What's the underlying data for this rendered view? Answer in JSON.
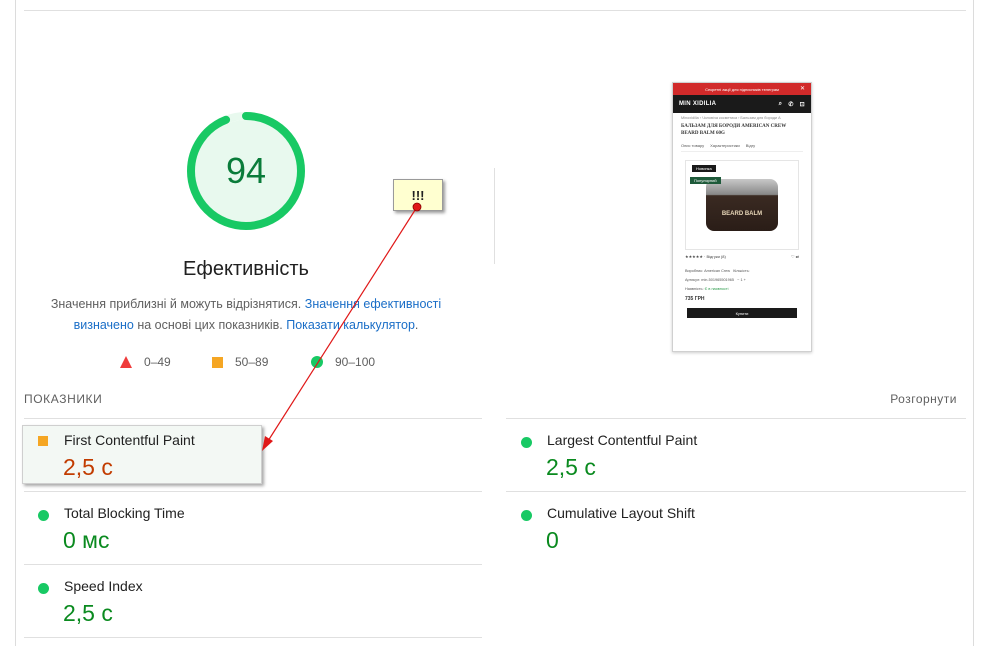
{
  "score": {
    "value": "94",
    "fraction": 0.94,
    "title": "Ефективність",
    "color": "#18c964"
  },
  "description": {
    "part1": "Значення приблизні й можуть відрізнятися. ",
    "link1": "Значення ефективності визначено",
    "part2": " на основі цих показників. ",
    "link2": "Показати калькулятор",
    "part3": "."
  },
  "legend": {
    "fail": "0–49",
    "average": "50–89",
    "pass": "90–100"
  },
  "thumbnail": {
    "banner": "Секретні акції для підписників телеграм",
    "logo": "MIN XIDILIA",
    "breadcrumb": "Minoxidilia  ›  Чоловіча косметика  ›  Бальзам для бороди A",
    "title": "БАЛЬЗАМ ДЛЯ БОРОДИ AMERICAN CREW BEARD BALM 60G",
    "tab1": "Опис товару",
    "tab2": "Характеристики",
    "tab3": "Відгу",
    "badge_new": "Новинка",
    "badge_popular": "Популярний",
    "product_label": "BEARD BALM",
    "reviews": "★★★★★ · Відгуки (8)",
    "maker_label": "Виробник:",
    "maker": "American Crew",
    "qty_label": "Кількість:",
    "sku_label": "Артикул:",
    "sku": "min-501965501965",
    "stock_label": "Наявність:",
    "stock": "Є в наявності",
    "price": "735 ГРН",
    "buy": "Купити"
  },
  "metrics": {
    "header": "ПОКАЗНИКИ",
    "expand": "Розгорнути",
    "items": [
      {
        "name": "First Contentful Paint",
        "value": "2,5 с"
      },
      {
        "name": "Largest Contentful Paint",
        "value": "2,5 с"
      },
      {
        "name": "Total Blocking Time",
        "value": "0 мс"
      },
      {
        "name": "Cumulative Layout Shift",
        "value": "0"
      },
      {
        "name": "Speed Index",
        "value": "2,5 с"
      }
    ]
  },
  "annotation": {
    "text": "!!!"
  },
  "colors": {
    "pass": "#18c964",
    "average": "#f5a623",
    "fail": "#ef3b3b",
    "link": "#1a6ec7",
    "red_arrow": "#e01818"
  }
}
